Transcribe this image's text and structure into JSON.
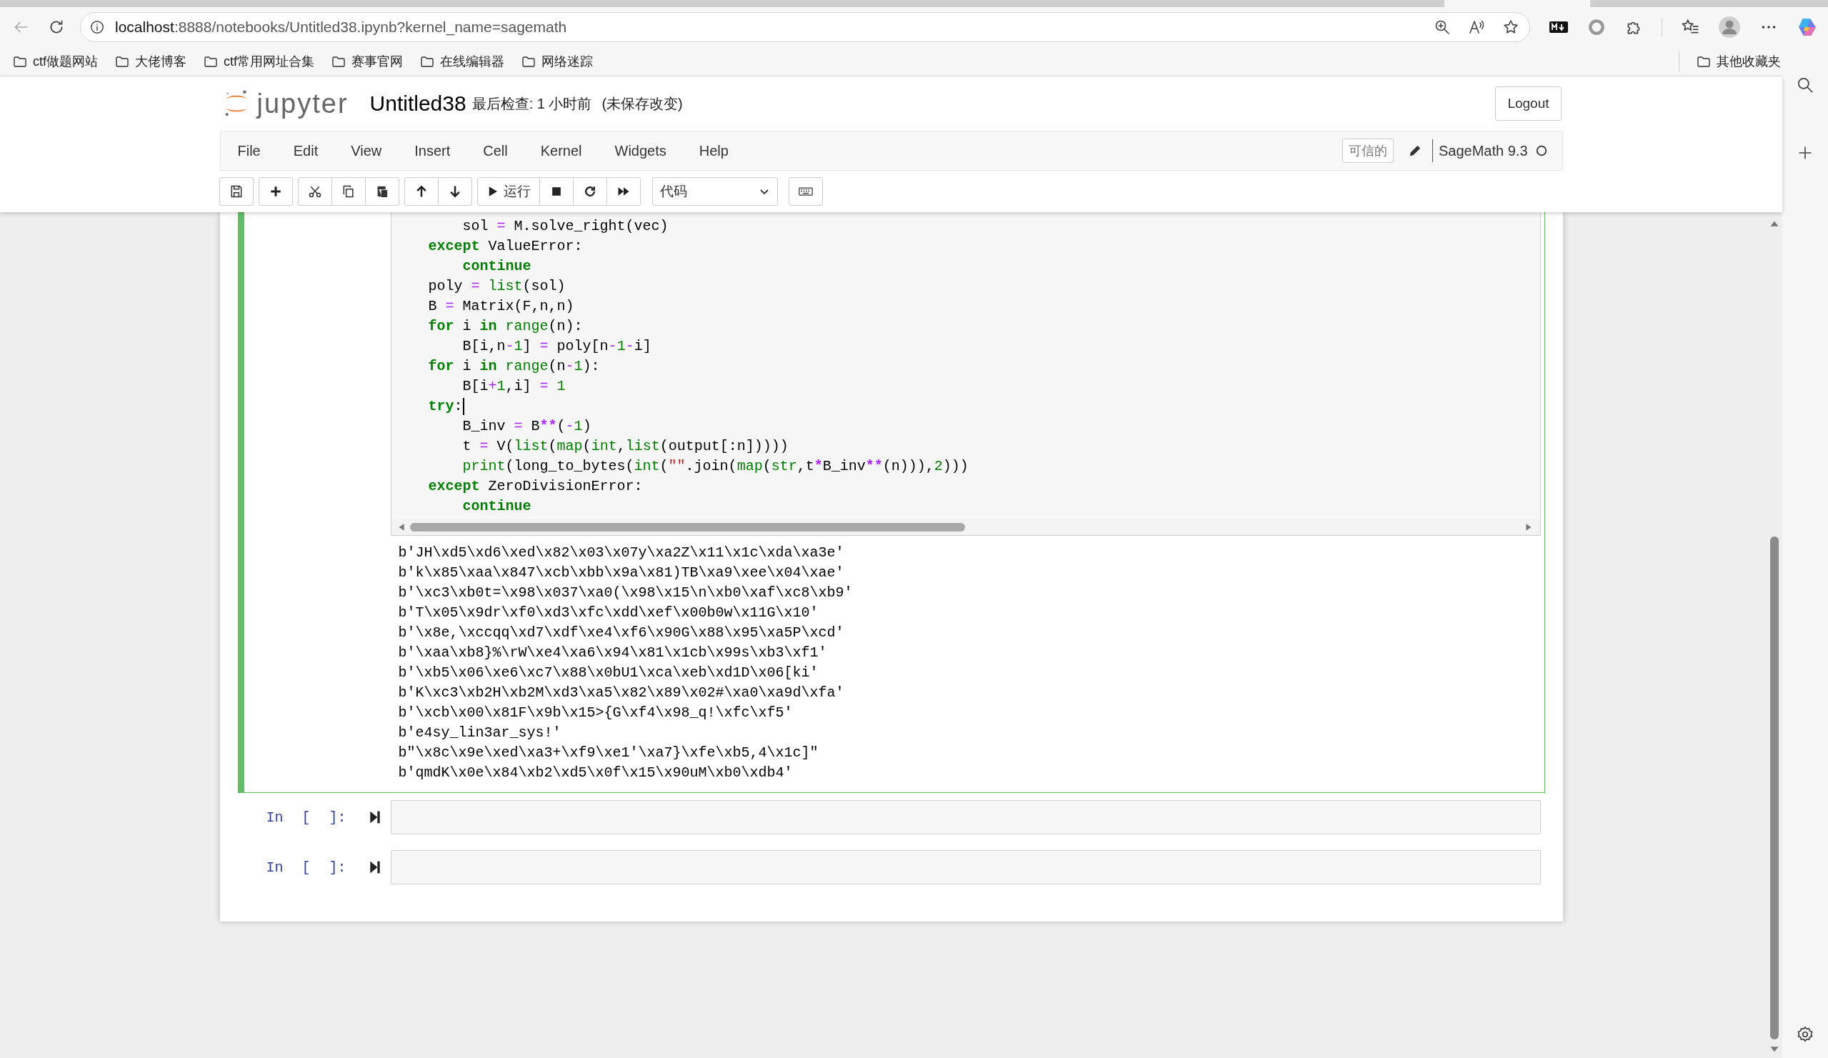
{
  "browser": {
    "url_host": "localhost",
    "url_rest": ":8888/notebooks/Untitled38.ipynb?kernel_name=sagemath",
    "bookmarks": [
      {
        "label": "ctf做题网站"
      },
      {
        "label": "大佬博客"
      },
      {
        "label": "ctf常用网址合集"
      },
      {
        "label": "赛事官网"
      },
      {
        "label": "在线编辑器"
      },
      {
        "label": "网络迷踪"
      }
    ],
    "other_bookmarks": "其他收藏夹"
  },
  "header": {
    "logo_text": "jupyter",
    "notebook_name": "Untitled38",
    "checkpoint": "最后检查: 1 小时前",
    "autosave": "(未保存改变)",
    "logout": "Logout"
  },
  "menu": [
    {
      "label": "File"
    },
    {
      "label": "Edit"
    },
    {
      "label": "View"
    },
    {
      "label": "Insert"
    },
    {
      "label": "Cell"
    },
    {
      "label": "Kernel"
    },
    {
      "label": "Widgets"
    },
    {
      "label": "Help"
    }
  ],
  "trusted": "可信的",
  "kernel": {
    "name": "SageMath 9.3",
    "busy": false
  },
  "toolbar": {
    "run_label": "运行",
    "cell_type": "代码"
  },
  "cells": [
    {
      "kind": "code",
      "selected": true,
      "code": [
        {
          "cursor": false,
          "tokens": [
            {
              "kind": "plain",
              "text": "        sol "
            },
            {
              "kind": "op",
              "text": "="
            },
            {
              "kind": "plain",
              "text": " M.solve_right(vec)"
            }
          ]
        },
        {
          "cursor": false,
          "tokens": [
            {
              "kind": "keyword",
              "text": "    except"
            },
            {
              "kind": "plain",
              "text": " ValueError:"
            }
          ]
        },
        {
          "cursor": false,
          "tokens": [
            {
              "kind": "keyword",
              "text": "        continue"
            }
          ]
        },
        {
          "cursor": false,
          "tokens": [
            {
              "kind": "plain",
              "text": "    poly "
            },
            {
              "kind": "op",
              "text": "="
            },
            {
              "kind": "builtin",
              "text": " list"
            },
            {
              "kind": "plain",
              "text": "(sol)"
            }
          ]
        },
        {
          "cursor": false,
          "tokens": [
            {
              "kind": "plain",
              "text": "    B "
            },
            {
              "kind": "op",
              "text": "="
            },
            {
              "kind": "plain",
              "text": " Matrix(F,n,n)"
            }
          ]
        },
        {
          "cursor": false,
          "tokens": [
            {
              "kind": "keyword",
              "text": "    for"
            },
            {
              "kind": "plain",
              "text": " i "
            },
            {
              "kind": "keyword",
              "text": "in"
            },
            {
              "kind": "builtin",
              "text": " range"
            },
            {
              "kind": "plain",
              "text": "(n):"
            }
          ]
        },
        {
          "cursor": false,
          "tokens": [
            {
              "kind": "plain",
              "text": "        B[i,n"
            },
            {
              "kind": "op",
              "text": "-"
            },
            {
              "kind": "number",
              "text": "1"
            },
            {
              "kind": "plain",
              "text": "] "
            },
            {
              "kind": "op",
              "text": "="
            },
            {
              "kind": "plain",
              "text": " poly[n"
            },
            {
              "kind": "op",
              "text": "-"
            },
            {
              "kind": "number",
              "text": "1"
            },
            {
              "kind": "op",
              "text": "-"
            },
            {
              "kind": "plain",
              "text": "i]"
            }
          ]
        },
        {
          "cursor": false,
          "tokens": [
            {
              "kind": "keyword",
              "text": "    for"
            },
            {
              "kind": "plain",
              "text": " i "
            },
            {
              "kind": "keyword",
              "text": "in"
            },
            {
              "kind": "builtin",
              "text": " range"
            },
            {
              "kind": "plain",
              "text": "(n"
            },
            {
              "kind": "op",
              "text": "-"
            },
            {
              "kind": "number",
              "text": "1"
            },
            {
              "kind": "plain",
              "text": "):"
            }
          ]
        },
        {
          "cursor": false,
          "tokens": [
            {
              "kind": "plain",
              "text": "        B[i"
            },
            {
              "kind": "op",
              "text": "+"
            },
            {
              "kind": "number",
              "text": "1"
            },
            {
              "kind": "plain",
              "text": ",i] "
            },
            {
              "kind": "op",
              "text": "="
            },
            {
              "kind": "number",
              "text": " 1"
            }
          ]
        },
        {
          "cursor": true,
          "tokens": [
            {
              "kind": "keyword",
              "text": "    try"
            },
            {
              "kind": "plain",
              "text": ":"
            }
          ]
        },
        {
          "cursor": false,
          "tokens": [
            {
              "kind": "plain",
              "text": "        B_inv "
            },
            {
              "kind": "op",
              "text": "="
            },
            {
              "kind": "plain",
              "text": " B"
            },
            {
              "kind": "op_bold",
              "text": "**"
            },
            {
              "kind": "plain",
              "text": "("
            },
            {
              "kind": "op",
              "text": "-"
            },
            {
              "kind": "number",
              "text": "1"
            },
            {
              "kind": "plain",
              "text": ")"
            }
          ]
        },
        {
          "cursor": false,
          "tokens": [
            {
              "kind": "plain",
              "text": "        t "
            },
            {
              "kind": "op",
              "text": "="
            },
            {
              "kind": "plain",
              "text": " V("
            },
            {
              "kind": "builtin",
              "text": "list"
            },
            {
              "kind": "plain",
              "text": "("
            },
            {
              "kind": "builtin",
              "text": "map"
            },
            {
              "kind": "plain",
              "text": "("
            },
            {
              "kind": "builtin",
              "text": "int"
            },
            {
              "kind": "plain",
              "text": ","
            },
            {
              "kind": "builtin",
              "text": "list"
            },
            {
              "kind": "plain",
              "text": "(output[:n]))))"
            }
          ]
        },
        {
          "cursor": false,
          "tokens": [
            {
              "kind": "builtin",
              "text": "        print"
            },
            {
              "kind": "plain",
              "text": "(long_to_bytes("
            },
            {
              "kind": "builtin",
              "text": "int"
            },
            {
              "kind": "plain",
              "text": "("
            },
            {
              "kind": "string",
              "text": "\"\""
            },
            {
              "kind": "plain",
              "text": ".join("
            },
            {
              "kind": "builtin",
              "text": "map"
            },
            {
              "kind": "plain",
              "text": "("
            },
            {
              "kind": "builtin",
              "text": "str"
            },
            {
              "kind": "plain",
              "text": ",t"
            },
            {
              "kind": "op_bold",
              "text": "*"
            },
            {
              "kind": "plain",
              "text": "B_inv"
            },
            {
              "kind": "op_bold",
              "text": "**"
            },
            {
              "kind": "plain",
              "text": "(n))),"
            },
            {
              "kind": "number",
              "text": "2"
            },
            {
              "kind": "plain",
              "text": ")))"
            }
          ]
        },
        {
          "cursor": false,
          "tokens": [
            {
              "kind": "keyword",
              "text": "    except"
            },
            {
              "kind": "plain",
              "text": " ZeroDivisionError:"
            }
          ]
        },
        {
          "cursor": false,
          "tokens": [
            {
              "kind": "keyword",
              "text": "        continue"
            }
          ]
        }
      ],
      "output": [
        "b'JH\\xd5\\xd6\\xed\\x82\\x03\\x07y\\xa2Z\\x11\\x1c\\xda\\xa3e'",
        "b'k\\x85\\xaa\\x847\\xcb\\xbb\\x9a\\x81)TB\\xa9\\xee\\x04\\xae'",
        "b'\\xc3\\xb0t=\\x98\\x037\\xa0(\\x98\\x15\\n\\xb0\\xaf\\xc8\\xb9'",
        "b'T\\x05\\x9dr\\xf0\\xd3\\xfc\\xdd\\xef\\x00b0w\\x11G\\x10'",
        "b'\\x8e,\\xccqq\\xd7\\xdf\\xe4\\xf6\\x90G\\x88\\x95\\xa5P\\xcd'",
        "b'\\xaa\\xb8}%\\rW\\xe4\\xa6\\x94\\x81\\x1cb\\x99s\\xb3\\xf1'",
        "b'\\xb5\\x06\\xe6\\xc7\\x88\\x0bU1\\xca\\xeb\\xd1D\\x06[ki'",
        "b'K\\xc3\\xb2H\\xb2M\\xd3\\xa5\\x82\\x89\\x02#\\xa0\\xa9d\\xfa'",
        "b'\\xcb\\x00\\x81F\\x9b\\x15>{G\\xf4\\x98_q!\\xfc\\xf5'",
        "b'e4sy_lin3ar_sys!'",
        "b\"\\x8c\\x9e\\xed\\xa3+\\xf9\\xe1'\\xa7}\\xfe\\xb5,4\\x1c]\"",
        "b'qmdK\\x0e\\x84\\xb2\\xd5\\x0f\\x15\\x90uM\\xb0\\xdb4'"
      ]
    },
    {
      "kind": "code",
      "selected": false,
      "prompt": "In [ ]:"
    },
    {
      "kind": "code",
      "selected": false,
      "prompt": "In [ ]:"
    }
  ]
}
